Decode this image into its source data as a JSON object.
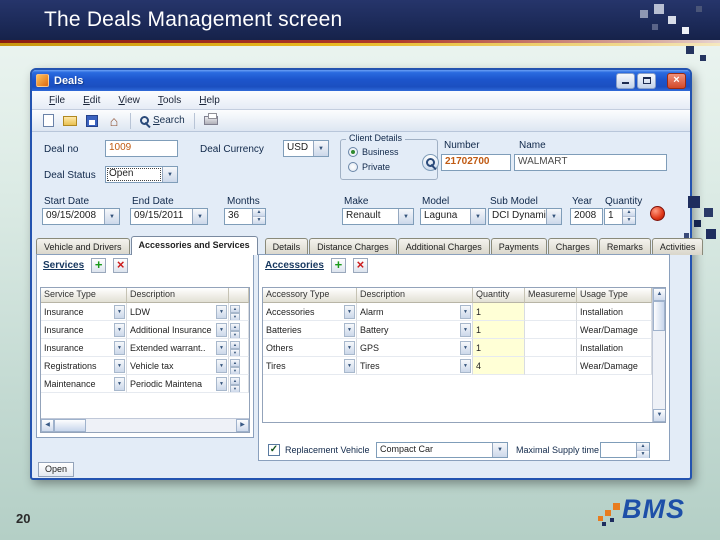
{
  "slide": {
    "title": "The Deals Management screen",
    "page_number": "20",
    "logo_text": "BMS"
  },
  "colors": {
    "header_navy": "#1e2b5c",
    "accent_red": "#a8301d",
    "accent_gold": "#ddab1c",
    "window_title_blue": "#2059cf",
    "value_orange": "#c05a12",
    "quantity_cell_yellow": "#ffffd6"
  },
  "window": {
    "title": "Deals",
    "menu": [
      "File",
      "Edit",
      "View",
      "Tools",
      "Help"
    ],
    "toolbar": {
      "search_label": "Search",
      "icons": [
        "new-document",
        "open",
        "save",
        "home",
        "search",
        "print"
      ]
    },
    "form": {
      "deal_no_label": "Deal no",
      "deal_no": "1009",
      "deal_currency_label": "Deal Currency",
      "deal_currency": "USD",
      "client_details_label": "Client Details",
      "business_label": "Business",
      "private_label": "Private",
      "number_label": "Number",
      "number": "21702700",
      "name_label": "Name",
      "name": "WALMART",
      "deal_status_label": "Deal Status",
      "deal_status": "Open",
      "start_date_label": "Start Date",
      "start_date": "09/15/2008",
      "end_date_label": "End Date",
      "end_date": "09/15/2011",
      "months_label": "Months",
      "months": "36",
      "make_label": "Make",
      "make": "Renault",
      "model_label": "Model",
      "model": "Laguna",
      "sub_model_label": "Sub Model",
      "sub_model": "DCI Dynamic",
      "year_label": "Year",
      "year": "2008",
      "quantity_label": "Quantity",
      "quantity": "1"
    },
    "tabs_left": [
      "Vehicle and Drivers",
      "Accessories and Services"
    ],
    "tabs_right": [
      "Details",
      "Distance Charges",
      "Additional Charges",
      "Payments",
      "Charges",
      "Remarks",
      "Activities"
    ],
    "active_tab": "Accessories and Services",
    "services": {
      "title": "Services",
      "headers": [
        "Service Type",
        "Description"
      ],
      "rows": [
        {
          "type": "Insurance",
          "desc": "LDW"
        },
        {
          "type": "Insurance",
          "desc": "Additional Insurance"
        },
        {
          "type": "Insurance",
          "desc": "Extended warrant.."
        },
        {
          "type": "Registrations",
          "desc": "Vehicle tax"
        },
        {
          "type": "Maintenance",
          "desc": "Periodic Maintena"
        }
      ]
    },
    "accessories": {
      "title": "Accessories",
      "headers": [
        "Accessory Type",
        "Description",
        "Quantity",
        "Measureme",
        "Usage Type"
      ],
      "rows": [
        {
          "type": "Accessories",
          "desc": "Alarm",
          "qty": "1",
          "measure": "",
          "usage": "Installation"
        },
        {
          "type": "Batteries",
          "desc": "Battery",
          "qty": "1",
          "measure": "",
          "usage": "Wear/Damage"
        },
        {
          "type": "Others",
          "desc": "GPS",
          "qty": "1",
          "measure": "",
          "usage": "Installation"
        },
        {
          "type": "Tires",
          "desc": "Tires",
          "qty": "4",
          "measure": "",
          "usage": "Wear/Damage"
        }
      ]
    },
    "footer": {
      "replacement_vehicle_label": "Replacement Vehicle",
      "replacement_vehicle_checked": true,
      "replacement_vehicle_value": "Compact Car",
      "maximal_supply_label": "Maximal Supply time",
      "status_open": "Open"
    }
  }
}
